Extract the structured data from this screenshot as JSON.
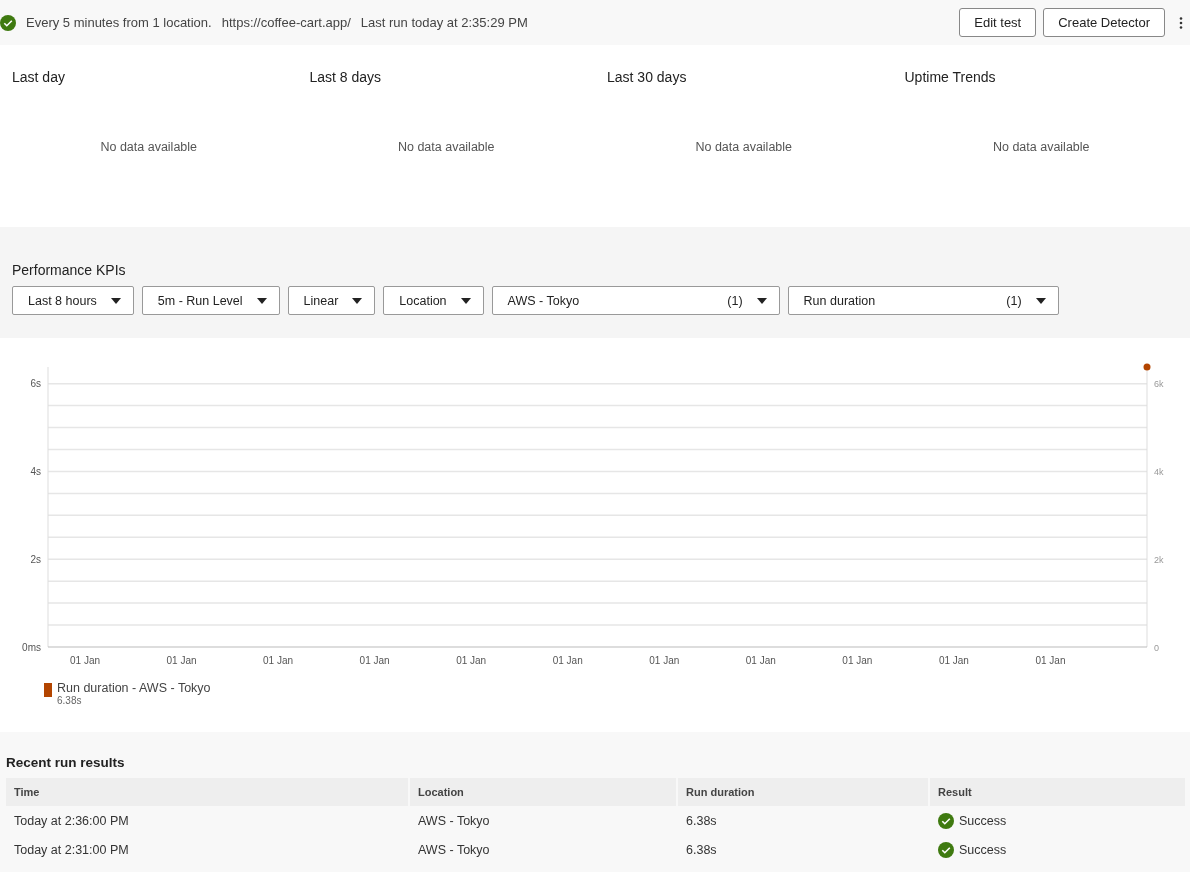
{
  "header": {
    "passed": true,
    "schedule": "Every 5 minutes from 1 location.",
    "url": "https://coffee-cart.app/",
    "last_run": "Last run today at 2:35:29 PM",
    "buttons": [
      "Edit test",
      "Create Detector"
    ]
  },
  "summary_cards": [
    {
      "title": "Last day",
      "message": "No data available"
    },
    {
      "title": "Last 8 days",
      "message": "No data available"
    },
    {
      "title": "Last 30 days",
      "message": "No data available"
    },
    {
      "title": "Uptime Trends",
      "message": "No data available"
    }
  ],
  "performance": {
    "title": "Performance KPIs",
    "filters": [
      {
        "label": "Last 8 hours",
        "kind": "plain"
      },
      {
        "label": "5m - Run Level",
        "kind": "plain"
      },
      {
        "label": "Linear",
        "kind": "plain"
      },
      {
        "label": "Location",
        "kind": "plain"
      },
      {
        "label": "AWS - Tokyo",
        "count": "(1)",
        "kind": "multi"
      },
      {
        "label": "Run duration",
        "count": "(1)",
        "kind": "multi"
      }
    ],
    "chart_data": {
      "type": "line",
      "categories": [
        "01 Jan",
        "01 Jan",
        "01 Jan",
        "01 Jan",
        "01 Jan",
        "01 Jan",
        "01 Jan",
        "01 Jan",
        "01 Jan",
        "01 Jan",
        "01 Jan",
        null
      ],
      "ylim": [
        0,
        6.38
      ],
      "y2lim": [
        0,
        6380
      ],
      "grid": true,
      "yticks": [
        {
          "value": 0,
          "label": "0ms"
        },
        {
          "value": 2,
          "label": "2s"
        },
        {
          "value": 4,
          "label": "4s"
        },
        {
          "value": 6,
          "label": "6s"
        }
      ],
      "y2ticks": [
        {
          "value": 0,
          "label": "0"
        },
        {
          "value": 2000,
          "label": "2k"
        },
        {
          "value": 4000,
          "label": "4k"
        },
        {
          "value": 6000,
          "label": "6k"
        }
      ],
      "series": [
        {
          "name": "Run duration - AWS - Tokyo",
          "color": "#b34500",
          "marker": "circle",
          "values": [
            null,
            null,
            null,
            null,
            null,
            null,
            null,
            null,
            null,
            null,
            null,
            6.38
          ]
        }
      ]
    },
    "legend_values": [
      "6.38s"
    ]
  },
  "results": {
    "title": "Recent run results",
    "columns": [
      "Time",
      "Location",
      "Run duration",
      "Result"
    ],
    "rows": [
      {
        "time": "Today at 2:36:00 PM",
        "location": "AWS - Tokyo",
        "duration": "6.38s",
        "result": "Success",
        "passed": true
      },
      {
        "time": "Today at 2:31:00 PM",
        "location": "AWS - Tokyo",
        "duration": "6.38s",
        "result": "Success",
        "passed": true
      }
    ]
  }
}
